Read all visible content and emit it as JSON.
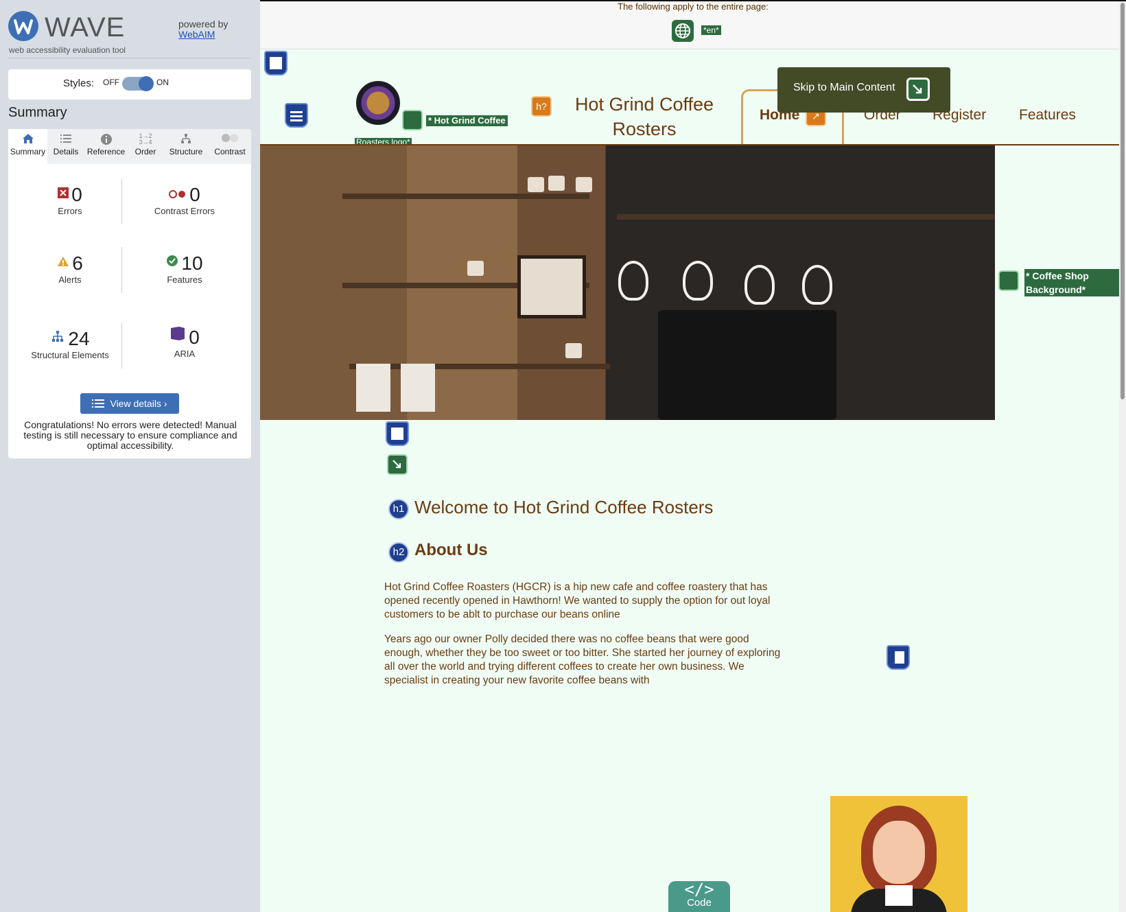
{
  "wave": {
    "title": "WAVE",
    "subtitle": "web accessibility evaluation tool",
    "powered_by": "powered by",
    "webaim_link": "WebAIM",
    "styles_label": "Styles:",
    "off_label": "OFF",
    "on_label": "ON",
    "styles_on": true,
    "summary_title": "Summary",
    "tabs": [
      {
        "label": "Summary",
        "icon": "home-icon",
        "active": true
      },
      {
        "label": "Details",
        "icon": "list-icon"
      },
      {
        "label": "Reference",
        "icon": "info-icon"
      },
      {
        "label": "Order",
        "icon": "order-icon"
      },
      {
        "label": "Structure",
        "icon": "structure-icon"
      },
      {
        "label": "Contrast",
        "icon": "contrast-icon"
      }
    ],
    "stats": {
      "errors": {
        "count": "0",
        "label": "Errors",
        "color": "#b0302f"
      },
      "contrast_errors": {
        "count": "0",
        "label": "Contrast Errors",
        "color": "#b0302f"
      },
      "alerts": {
        "count": "6",
        "label": "Alerts",
        "color": "#e3a22c"
      },
      "features": {
        "count": "10",
        "label": "Features",
        "color": "#3f8a4f"
      },
      "structural": {
        "count": "24",
        "label": "Structural Elements",
        "color": "#3e6fb5"
      },
      "aria": {
        "count": "0",
        "label": "ARIA",
        "color": "#5b3a8f"
      }
    },
    "view_details": "View details ›",
    "congrats": "Congratulations! No errors were detected! Manual testing is still necessary to ensure compliance and optimal accessibility."
  },
  "page": {
    "applies_text": "The following apply to the entire page:",
    "lang_tag": "*en*",
    "logo_alt_label": "* Hot Grind Coffee",
    "logo_alt_label_2": "Roasters logo*",
    "site_title": "Hot Grind Coffee Rosters",
    "h_unknown_badge": "h?",
    "skip_link": "Skip to Main Content",
    "nav": [
      "Home",
      "Order",
      "Register",
      "Features"
    ],
    "bg_label": "* Coffee Shop Background*",
    "h1_badge": "h1",
    "h1": "Welcome to Hot Grind Coffee Rosters",
    "h2_badge": "h2",
    "h2": "About Us",
    "para1": "Hot Grind Coffee Roasters (HGCR) is a hip new cafe and coffee roastery that has opened recently opened in Hawthorn! We wanted to supply the option for out loyal customers to be ablt to purchase our beans online",
    "para2": "Years ago our owner Polly decided there was no coffee beans that were good enough, whether they be too sweet or too bitter. She started her journey of exploring all over the world and trying different coffees to create her own business. We specialist in creating your new favorite coffee beans with",
    "code_glyph": "</>",
    "code_label": "Code"
  },
  "colors": {
    "wave_blue": "#3e6fb5",
    "page_bg": "#effdf5",
    "brand_brown": "#6b3b10",
    "wave_green": "#2d6b3f"
  }
}
